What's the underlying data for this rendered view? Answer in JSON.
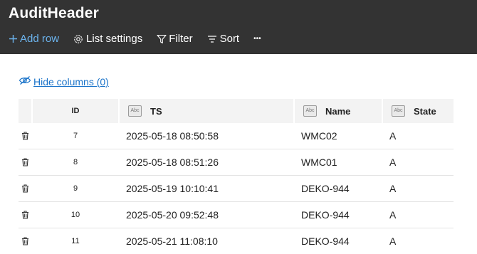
{
  "app": {
    "title": "AuditHeader"
  },
  "toolbar": {
    "add_row": "Add row",
    "list_settings": "List settings",
    "filter": "Filter",
    "sort": "Sort",
    "more": "•••"
  },
  "hide_columns": {
    "label": "Hide columns (0)"
  },
  "table": {
    "columns": [
      {
        "label": "ID"
      },
      {
        "label": "TS",
        "type_icon": "abc-text-icon"
      },
      {
        "label": "Name",
        "type_icon": "abc-text-icon"
      },
      {
        "label": "State",
        "type_icon": "abc-text-icon"
      }
    ],
    "type_icon_text": "Abc",
    "rows": [
      {
        "id": "7",
        "ts": "2025-05-18 08:50:58",
        "name": "WMC02",
        "state": "A"
      },
      {
        "id": "8",
        "ts": "2025-05-18 08:51:26",
        "name": "WMC01",
        "state": "A"
      },
      {
        "id": "9",
        "ts": "2025-05-19 10:10:41",
        "name": "DEKO-944",
        "state": "A"
      },
      {
        "id": "10",
        "ts": "2025-05-20 09:52:48",
        "name": "DEKO-944",
        "state": "A"
      },
      {
        "id": "11",
        "ts": "2025-05-21 11:08:10",
        "name": "DEKO-944",
        "state": "A"
      }
    ]
  },
  "colors": {
    "topbar": "#333333",
    "accent": "#6cb4ee",
    "link": "#1a73c9"
  }
}
